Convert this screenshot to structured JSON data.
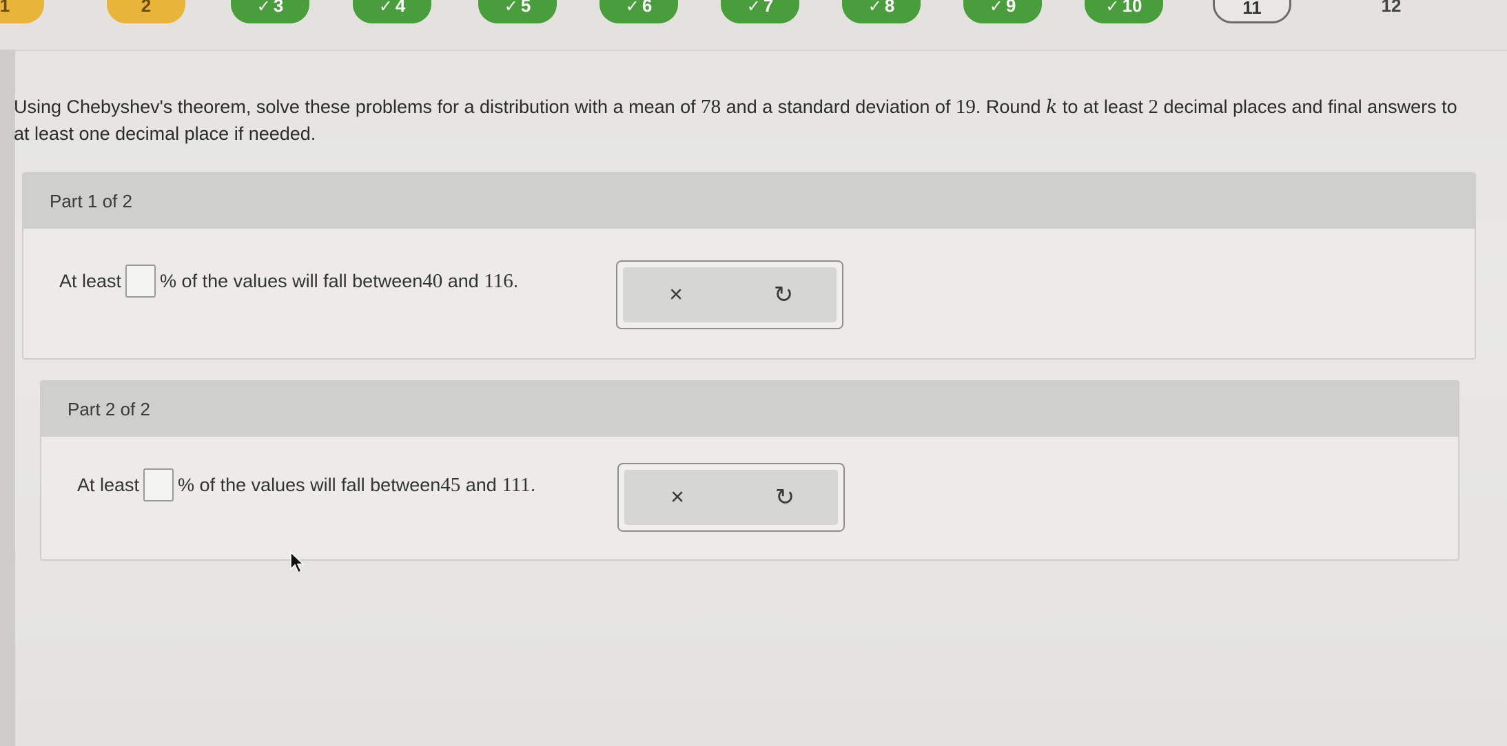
{
  "nav": {
    "questions": [
      {
        "label": "1",
        "status": "partial"
      },
      {
        "label": "2",
        "status": "partial"
      },
      {
        "label": "3",
        "status": "done"
      },
      {
        "label": "4",
        "status": "done"
      },
      {
        "label": "5",
        "status": "done"
      },
      {
        "label": "6",
        "status": "done"
      },
      {
        "label": "7",
        "status": "done"
      },
      {
        "label": "8",
        "status": "done"
      },
      {
        "label": "9",
        "status": "done"
      },
      {
        "label": "10",
        "status": "done"
      },
      {
        "label": "11",
        "status": "current"
      },
      {
        "label": "12",
        "status": "todo"
      }
    ]
  },
  "prompt": {
    "part_a": "Using Chebyshev's theorem, solve these problems for a distribution with a mean of ",
    "mean": "78",
    "part_b": " and a standard deviation of ",
    "sd": "19",
    "part_c": ". Round ",
    "k": "k",
    "part_d": " to at least ",
    "places": "2",
    "part_e": " decimal places and final answers to at least one decimal place if needed."
  },
  "parts": [
    {
      "header": "Part 1 of 2",
      "lead": "At least",
      "tail": "% of the values will fall between ",
      "low": "40",
      "and": " and ",
      "high": "116",
      "end": ".",
      "clear_icon": "×",
      "undo_icon": "↻"
    },
    {
      "header": "Part 2 of 2",
      "lead": "At least",
      "tail": "% of the values will fall between ",
      "low": "45",
      "and": " and ",
      "high": "111",
      "end": ".",
      "clear_icon": "×",
      "undo_icon": "↻"
    }
  ]
}
